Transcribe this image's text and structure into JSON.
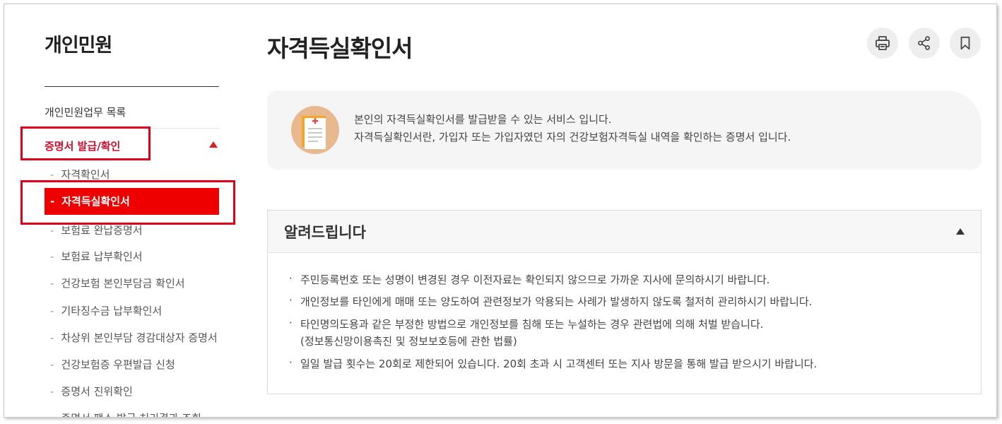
{
  "sidebar": {
    "title": "개인민원",
    "top_item": "개인민원업무 목록",
    "active_group": "증명서 발급/확인",
    "dash": "-",
    "items": [
      {
        "label": "자격확인서"
      },
      {
        "label": "자격득실확인서"
      },
      {
        "label": "보험료 완납증명서"
      },
      {
        "label": "보험료 납부확인서"
      },
      {
        "label": "건강보험 본인부담금 확인서"
      },
      {
        "label": "기타징수금 납부확인서"
      },
      {
        "label": "차상위 본인부담 경감대상자 증명서"
      },
      {
        "label": "건강보험증 우편발급 신청"
      },
      {
        "label": "증명서 진위확인"
      },
      {
        "label": "증명서 팩스 발급 처리결과 조회"
      }
    ]
  },
  "main": {
    "title": "자격득실확인서",
    "actions": [
      "print-icon",
      "share-icon",
      "bookmark-icon"
    ],
    "info": {
      "line1": "본인의 자격득실확인서를 발급받을 수 있는 서비스 입니다.",
      "line2": "자격득실확인서란, 가입자 또는 가입자였던 자의 건강보험자격득실 내역을 확인하는 증명서 입니다."
    },
    "notice": {
      "title": "알려드립니다",
      "bullet": "·",
      "items": [
        "주민등록번호 또는 성명이 변경된 경우 이전자료는 확인되지 않으므로 가까운 지사에 문의하시기 바랍니다.",
        "개인정보를 타인에게 매매 또는 양도하여 관련정보가 악용되는 사례가 발생하지 않도록 철저히 관리하시기 바랍니다.",
        "타인명의도용과 같은 부정한 방법으로 개인정보를 침해 또는 누설하는 경우 관련법에 의해 처벌 받습니다.",
        "(정보통신망이용촉진 및 정보보호등에 관한 법률)",
        "일일 발급 횟수는 20회로 제한되어 있습니다. 20회 초과 시 고객센터 또는 지사 방문을 통해 발급 받으시기 바랍니다."
      ]
    }
  },
  "colors": {
    "accent": "#ee0000",
    "highlight_box": "#e0001b",
    "active_text": "#c8102e"
  }
}
